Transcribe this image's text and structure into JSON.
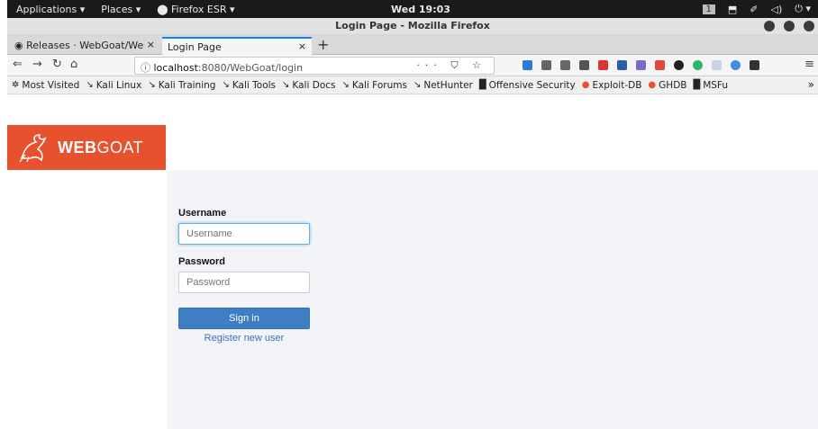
{
  "gnome": {
    "applications": "Applications ▾",
    "places": "Places ▾",
    "firefox": "Firefox ESR ▾",
    "clock": "Wed 19:03",
    "workspace": "1"
  },
  "window": {
    "title": "Login Page - Mozilla Firefox"
  },
  "tabs": [
    {
      "label": "Releases · WebGoat/We",
      "close": "×"
    },
    {
      "label": "Login Page",
      "close": "×"
    }
  ],
  "newtab": "+",
  "nav": {
    "url_host": "localhost",
    "url_rest": ":8080/WebGoat/login",
    "url_actions": "··· ⛉ ☆"
  },
  "bookmarks": [
    {
      "label": "Most Visited",
      "icon": "gear-icon"
    },
    {
      "label": "Kali Linux",
      "icon": "kali-dragon-icon"
    },
    {
      "label": "Kali Training",
      "icon": "kali-dragon-icon"
    },
    {
      "label": "Kali Tools",
      "icon": "kali-dragon-icon"
    },
    {
      "label": "Kali Docs",
      "icon": "kali-dragon-icon"
    },
    {
      "label": "Kali Forums",
      "icon": "kali-dragon-icon"
    },
    {
      "label": "NetHunter",
      "icon": "kali-dragon-icon"
    },
    {
      "label": "Offensive Security",
      "icon": "offsec-icon"
    },
    {
      "label": "Exploit-DB",
      "icon": "exploitdb-icon"
    },
    {
      "label": "GHDB",
      "icon": "exploitdb-icon"
    },
    {
      "label": "MSFu",
      "icon": "offsec-icon"
    }
  ],
  "brand": {
    "logo_bold": "WEB",
    "logo_rest": "GOAT"
  },
  "login": {
    "username_label": "Username",
    "username_placeholder": "Username",
    "password_label": "Password",
    "password_placeholder": "Password",
    "signin": "Sign in",
    "register": "Register new user"
  },
  "colors": {
    "brand": "#e8512d",
    "button": "#3f7ec2",
    "link": "#3a6fb4",
    "content_bg": "#f3f4f7"
  }
}
